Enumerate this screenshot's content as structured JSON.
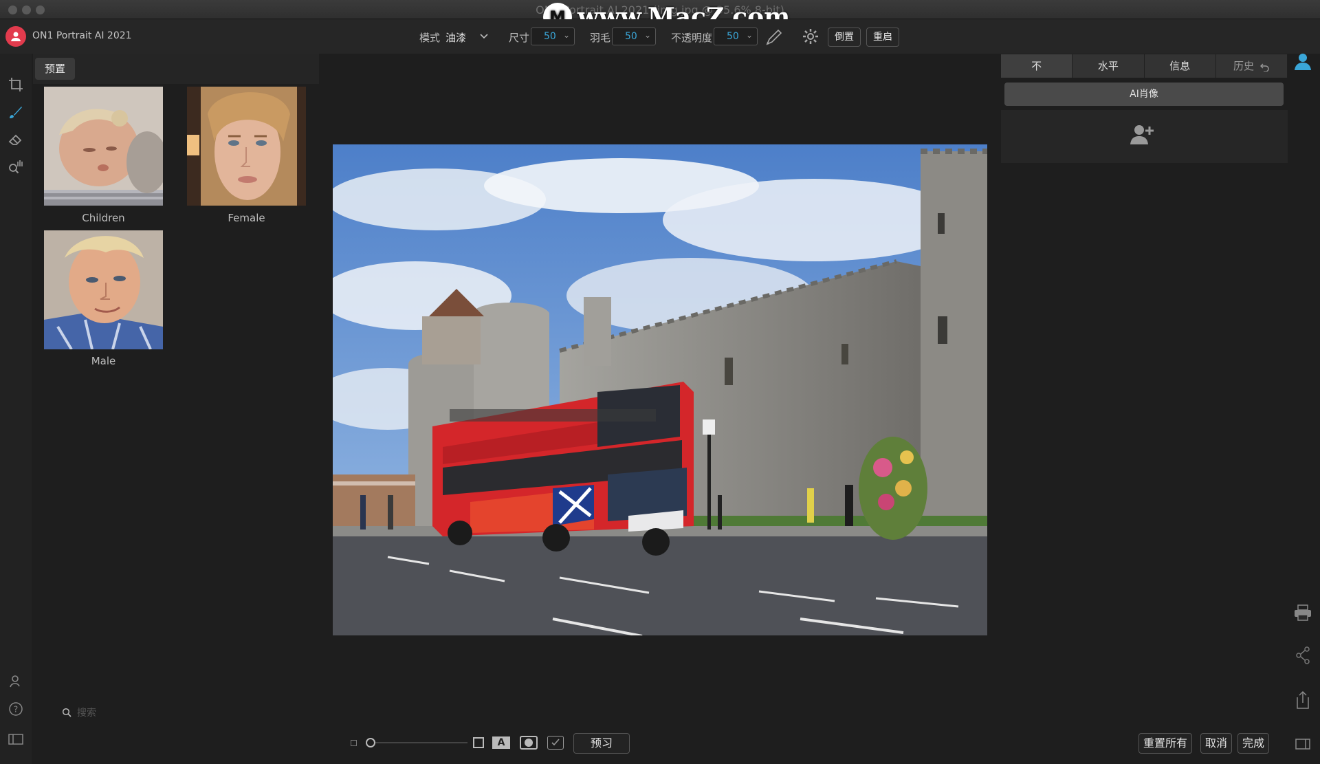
{
  "window": {
    "title": "ON1 Portrait AI 2021 (img.jpg @ 35.6% 8-bit)"
  },
  "watermark": {
    "logo_letter": "M",
    "text": "www.MacZ.com"
  },
  "app": {
    "name": "ON1 Portrait AI 2021",
    "accent_color": "#3aa6d8",
    "logo_color": "#e23b4d"
  },
  "toolbar": {
    "mode_label": "模式",
    "mode_value": "油漆",
    "size_label": "尺寸",
    "size_value": "50",
    "feather_label": "羽毛",
    "feather_value": "50",
    "opacity_label": "不透明度",
    "opacity_value": "50",
    "invert_label": "倒置",
    "reset_label": "重启"
  },
  "left_tools": [
    "crop-icon",
    "brush-icon",
    "eraser-icon",
    "zoom-hand-icon"
  ],
  "presets": {
    "tab_label": "预置",
    "items": [
      {
        "label": "Children"
      },
      {
        "label": "Female"
      },
      {
        "label": "Male"
      }
    ],
    "search_placeholder": "搜索"
  },
  "right_panel": {
    "tabs": [
      {
        "label": "不",
        "active": true
      },
      {
        "label": "水平",
        "active": false
      },
      {
        "label": "信息",
        "active": false
      },
      {
        "label": "历史",
        "active": false
      }
    ],
    "ai_button_label": "AI肖像"
  },
  "bottom": {
    "preview_label": "预习",
    "reset_all_label": "重置所有",
    "cancel_label": "取消",
    "done_label": "完成"
  }
}
